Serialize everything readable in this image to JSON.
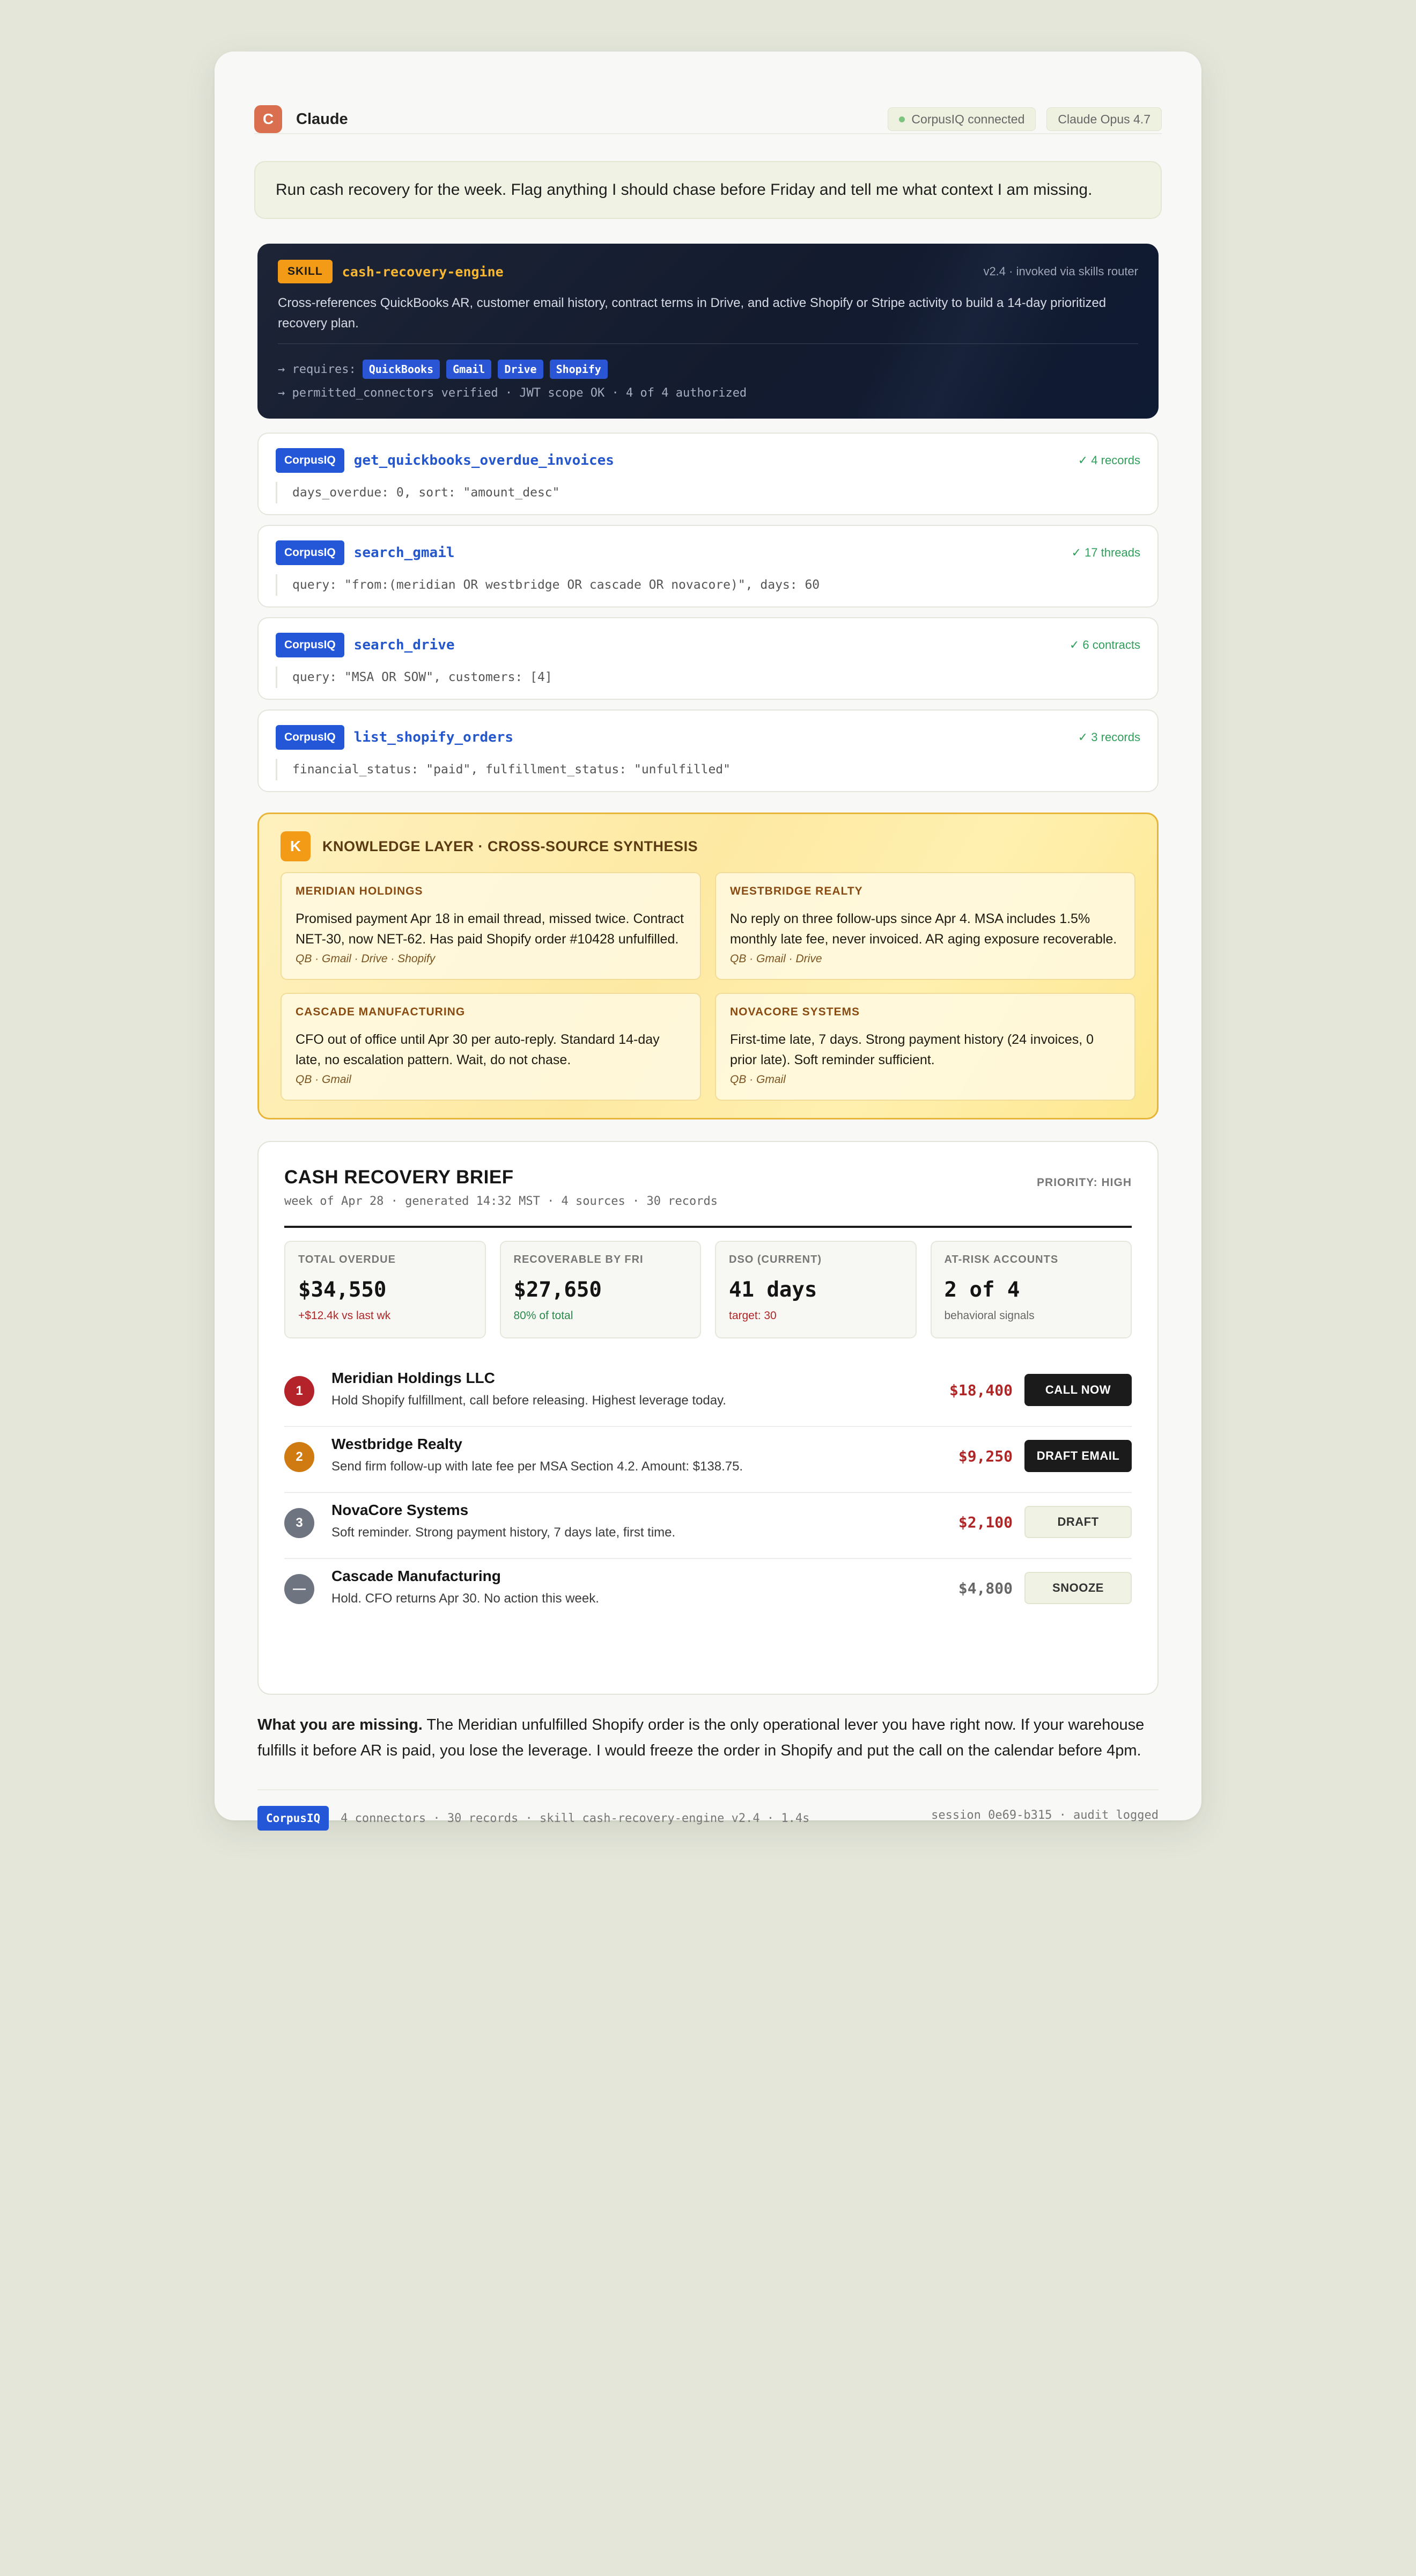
{
  "header": {
    "logo_letter": "C",
    "app_name": "Claude",
    "connection_status": "CorpusIQ connected",
    "model": "Claude Opus 4.7"
  },
  "prompt": {
    "text": "Run cash recovery for the week. Flag anything I should chase before Friday and tell me what context I am missing."
  },
  "skill": {
    "badge": "SKILL",
    "name": "cash-recovery-engine",
    "version": "v2.4 · invoked via skills router",
    "description": "Cross-references QuickBooks AR, customer email history, contract terms in Drive, and active Shopify or Stripe activity to build a 14-day prioritized recovery plan.",
    "requires_label": "→ requires:",
    "requires": [
      "QuickBooks",
      "Gmail",
      "Drive",
      "Shopify"
    ],
    "permissions": "→ permitted_connectors verified · JWT scope OK · 4 of 4 authorized"
  },
  "tools": [
    {
      "badge": "CorpusIQ",
      "name": "get_quickbooks_overdue_invoices",
      "status": "✓ 4 records",
      "args": "days_overdue: 0, sort: \"amount_desc\""
    },
    {
      "badge": "CorpusIQ",
      "name": "search_gmail",
      "status": "✓ 17 threads",
      "args": "query: \"from:(meridian OR westbridge OR cascade OR novacore)\", days: 60"
    },
    {
      "badge": "CorpusIQ",
      "name": "search_drive",
      "status": "✓ 6 contracts",
      "args": "query: \"MSA OR SOW\", customers: [4]"
    },
    {
      "badge": "CorpusIQ",
      "name": "list_shopify_orders",
      "status": "✓ 3 records",
      "args": "financial_status: \"paid\", fulfillment_status: \"unfulfilled\""
    }
  ],
  "knowledge": {
    "icon_letter": "K",
    "title": "KNOWLEDGE LAYER · CROSS-SOURCE SYNTHESIS",
    "cards": [
      {
        "company": "MERIDIAN HOLDINGS",
        "text": "Promised payment Apr 18 in email thread, missed twice. Contract NET-30, now NET-62. Has paid Shopify order #10428 unfulfilled.",
        "sources": "QB · Gmail · Drive · Shopify"
      },
      {
        "company": "WESTBRIDGE REALTY",
        "text": "No reply on three follow-ups since Apr 4. MSA includes 1.5% monthly late fee, never invoiced. AR aging exposure recoverable.",
        "sources": "QB · Gmail · Drive"
      },
      {
        "company": "CASCADE MANUFACTURING",
        "text": "CFO out of office until Apr 30 per auto-reply. Standard 14-day late, no escalation pattern. Wait, do not chase.",
        "sources": "QB · Gmail"
      },
      {
        "company": "NOVACORE SYSTEMS",
        "text": "First-time late, 7 days. Strong payment history (24 invoices, 0 prior late). Soft reminder sufficient.",
        "sources": "QB · Gmail"
      }
    ]
  },
  "brief": {
    "title": "CASH RECOVERY BRIEF",
    "meta": "week of Apr 28 · generated 14:32 MST · 4 sources · 30 records",
    "priority": "PRIORITY: HIGH",
    "kpis": [
      {
        "label": "TOTAL OVERDUE",
        "value": "$34,550",
        "sub": "+$12.4k vs last wk",
        "tone": "red"
      },
      {
        "label": "RECOVERABLE BY FRI",
        "value": "$27,650",
        "sub": "80% of total",
        "tone": "green"
      },
      {
        "label": "DSO (CURRENT)",
        "value": "41 days",
        "sub": "target: 30",
        "tone": "red"
      },
      {
        "label": "AT-RISK ACCOUNTS",
        "value": "2 of 4",
        "sub": "behavioral signals",
        "tone": "gray"
      }
    ],
    "rows": [
      {
        "rank": "1",
        "rank_color": "#b5232a",
        "name": "Meridian Holdings LLC",
        "desc": "Hold Shopify fulfillment, call before releasing. Highest leverage today.",
        "amount": "$18,400",
        "amount_color": "#b02525",
        "action": "CALL NOW",
        "action_style": "dark"
      },
      {
        "rank": "2",
        "rank_color": "#d07a12",
        "name": "Westbridge Realty",
        "desc": "Send firm follow-up with late fee per MSA Section 4.2. Amount: $138.75.",
        "amount": "$9,250",
        "amount_color": "#b02525",
        "action": "DRAFT EMAIL",
        "action_style": "dark"
      },
      {
        "rank": "3",
        "rank_color": "#6e7480",
        "name": "NovaCore Systems",
        "desc": "Soft reminder. Strong payment history, 7 days late, first time.",
        "amount": "$2,100",
        "amount_color": "#b02525",
        "action": "DRAFT",
        "action_style": "light"
      },
      {
        "rank": "—",
        "rank_color": "#6e7480",
        "name": "Cascade Manufacturing",
        "desc": "Hold. CFO returns Apr 30. No action this week.",
        "amount": "$4,800",
        "amount_color": "#666666",
        "action": "SNOOZE",
        "action_style": "light"
      }
    ]
  },
  "missing": {
    "lead": "What you are missing.",
    "text": " The Meridian unfulfilled Shopify order is the only operational lever you have right now. If your warehouse fulfills it before AR is paid, you lose the leverage. I would freeze the order in Shopify and put the call on the calendar before 4pm."
  },
  "footer": {
    "badge": "CorpusIQ",
    "meta": "4 connectors · 30 records · skill cash-recovery-engine v2.4 · 1.4s",
    "session": "session 0e69-b315 · audit logged"
  }
}
